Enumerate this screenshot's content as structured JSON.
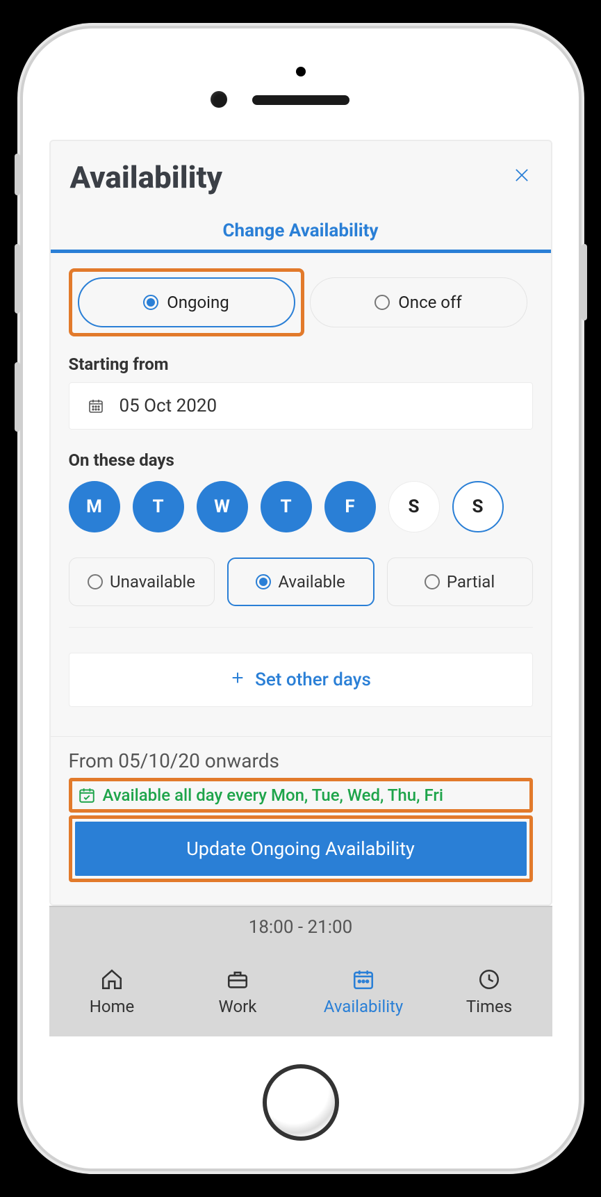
{
  "header": {
    "title": "Availability",
    "tab": "Change Availability"
  },
  "frequency": {
    "ongoing": "Ongoing",
    "once_off": "Once off",
    "selected": "ongoing"
  },
  "starting": {
    "label": "Starting from",
    "value": "05 Oct 2020"
  },
  "days": {
    "label": "On these days",
    "items": [
      {
        "letter": "M",
        "selected": true
      },
      {
        "letter": "T",
        "selected": true
      },
      {
        "letter": "W",
        "selected": true
      },
      {
        "letter": "T",
        "selected": true
      },
      {
        "letter": "F",
        "selected": true
      },
      {
        "letter": "S",
        "selected": false
      },
      {
        "letter": "S",
        "selected": false
      }
    ]
  },
  "status": {
    "options": {
      "unavailable": "Unavailable",
      "available": "Available",
      "partial": "Partial"
    },
    "selected": "available"
  },
  "set_other": "Set other days",
  "summary": {
    "from_line": "From 05/10/20 onwards",
    "avail_line": "Available all day every Mon, Tue, Wed, Thu, Fri"
  },
  "primary_button": "Update Ongoing Availability",
  "behind_time": "18:00 - 21:00",
  "nav": {
    "home": "Home",
    "work": "Work",
    "availability": "Availability",
    "times": "Times",
    "active": "availability"
  }
}
